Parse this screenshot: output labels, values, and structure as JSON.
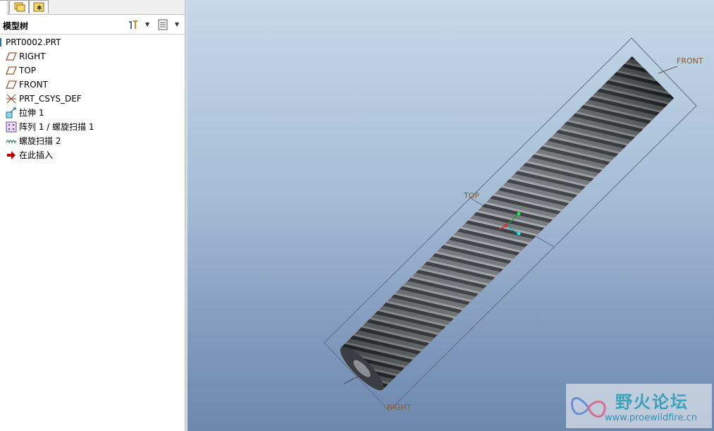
{
  "panel": {
    "title": "模型树"
  },
  "tree": {
    "root": "PRT0002.PRT",
    "items": [
      {
        "label": "RIGHT",
        "icon": "datum-plane-icon"
      },
      {
        "label": "TOP",
        "icon": "datum-plane-icon"
      },
      {
        "label": "FRONT",
        "icon": "datum-plane-icon"
      },
      {
        "label": "PRT_CSYS_DEF",
        "icon": "coordinate-system-icon"
      },
      {
        "label": "拉伸 1",
        "icon": "extrude-icon"
      },
      {
        "label": "阵列 1 / 螺旋扫描 1",
        "icon": "pattern-icon"
      },
      {
        "label": "螺旋扫描 2",
        "icon": "helical-sweep-icon"
      },
      {
        "label": "在此插入",
        "icon": "insert-here-arrow-icon"
      }
    ]
  },
  "viewport": {
    "datum_labels": {
      "front": "FRONT",
      "top": "TOP",
      "right": "RIGHT"
    }
  },
  "watermark": {
    "title": "野火论坛",
    "url": "www.proewildfire.cn"
  },
  "colors": {
    "viewport_top": "#c6d9ea",
    "viewport_bottom": "#6d87ad",
    "datum_label": "#8a5a2a",
    "model": "#5a5e63"
  }
}
